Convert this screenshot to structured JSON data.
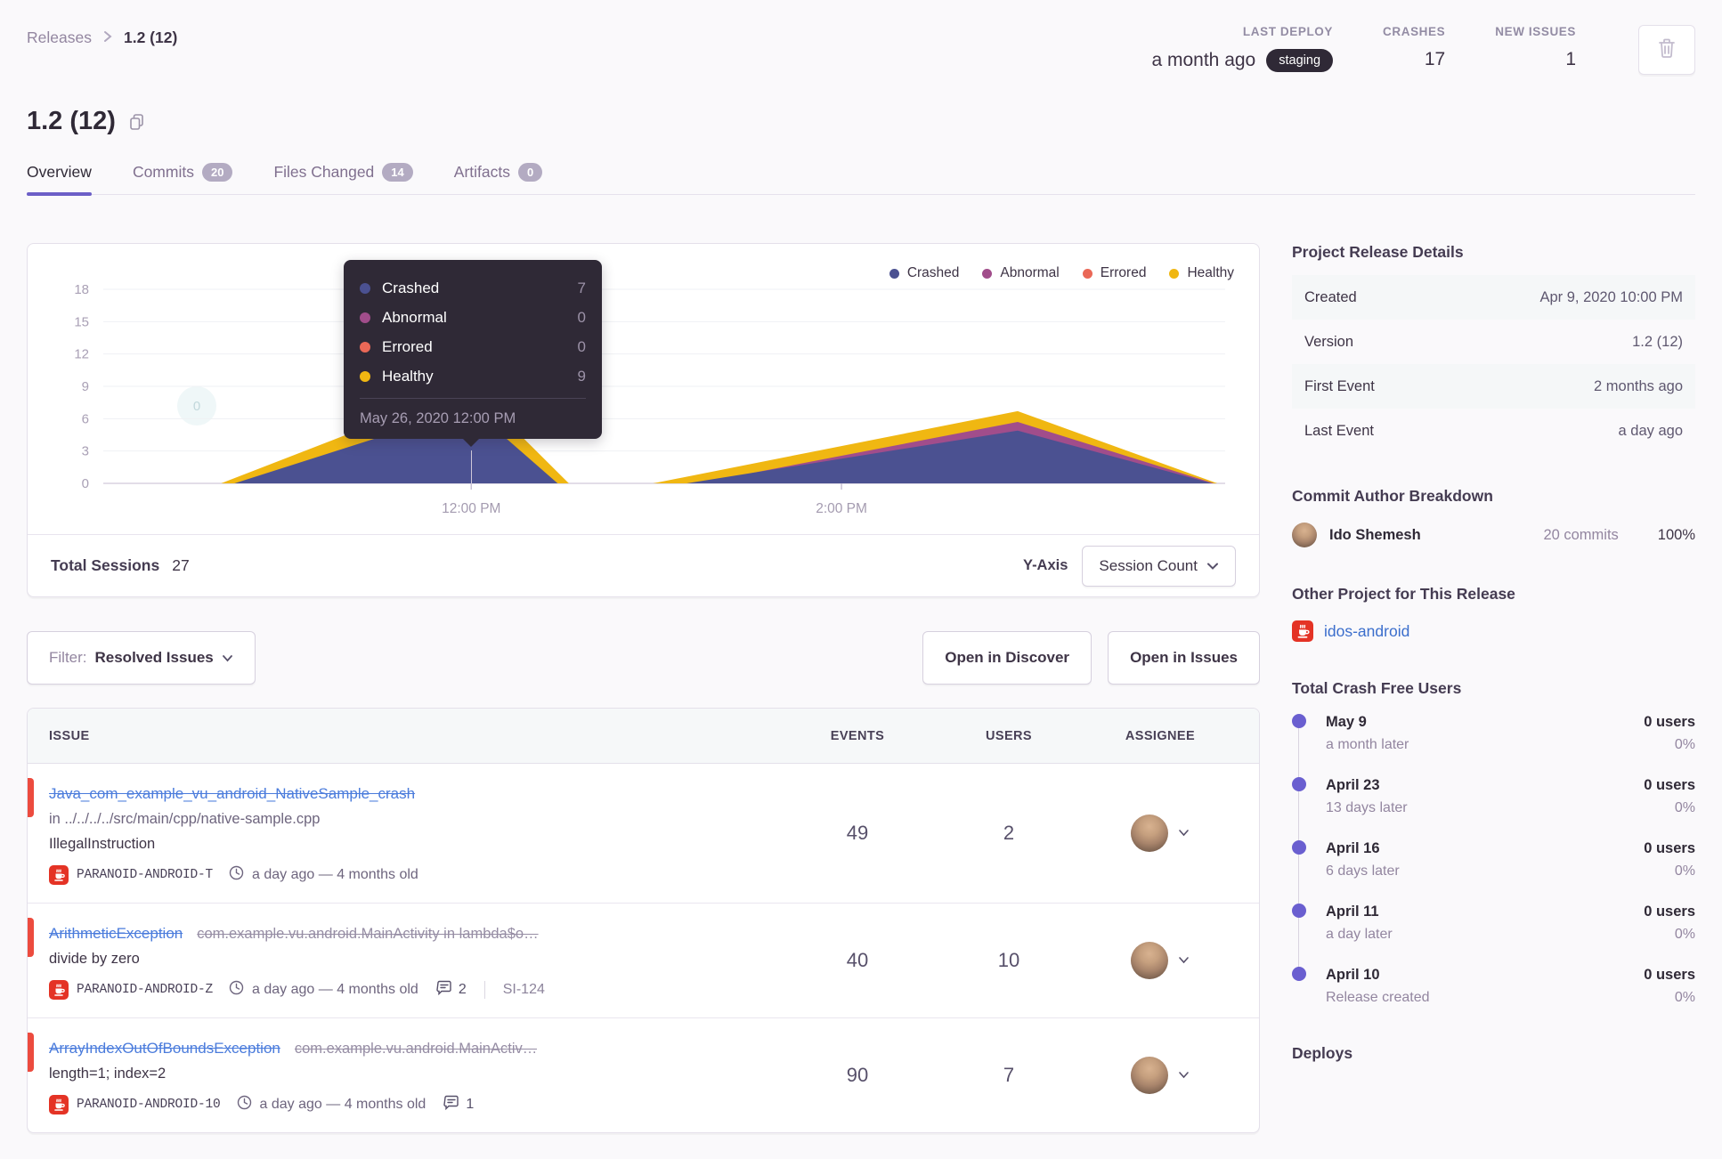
{
  "breadcrumb": {
    "parent": "Releases",
    "current": "1.2 (12)"
  },
  "header_stats": {
    "last_deploy": {
      "label": "LAST DEPLOY",
      "value": "a month ago",
      "badge": "staging"
    },
    "crashes": {
      "label": "CRASHES",
      "value": "17"
    },
    "new_issues": {
      "label": "NEW ISSUES",
      "value": "1"
    }
  },
  "page_title": "1.2 (12)",
  "tabs": [
    {
      "label": "Overview"
    },
    {
      "label": "Commits",
      "count": "20"
    },
    {
      "label": "Files Changed",
      "count": "14"
    },
    {
      "label": "Artifacts",
      "count": "0"
    }
  ],
  "chart_data": {
    "type": "area",
    "legend": [
      "Crashed",
      "Abnormal",
      "Errored",
      "Healthy"
    ],
    "colors": {
      "Crashed": "#4B5191",
      "Abnormal": "#A14D8B",
      "Errored": "#EA6857",
      "Healthy": "#F0B712"
    },
    "y_ticks": [
      0,
      3,
      6,
      9,
      12,
      15,
      18
    ],
    "ylim": [
      0,
      19
    ],
    "x_ticks": [
      {
        "label": "12:00 PM",
        "f": 0.328
      },
      {
        "label": "2:00 PM",
        "f": 0.658
      }
    ],
    "series": [
      {
        "name": "Crashed",
        "points": [
          [
            0.117,
            0
          ],
          [
            0.328,
            7
          ],
          [
            0.405,
            0
          ],
          [
            0.52,
            0
          ],
          [
            0.815,
            4.9
          ],
          [
            0.988,
            0
          ]
        ]
      },
      {
        "name": "Abnormal",
        "points": [
          [
            0.53,
            0
          ],
          [
            0.815,
            5.7
          ],
          [
            0.99,
            0
          ]
        ]
      },
      {
        "name": "Errored",
        "points": []
      },
      {
        "name": "Healthy",
        "points": [
          [
            0.105,
            0
          ],
          [
            0.328,
            9
          ],
          [
            0.415,
            0
          ],
          [
            0.49,
            0
          ],
          [
            0.815,
            6.7
          ],
          [
            0.993,
            0
          ]
        ]
      }
    ],
    "draw_order": [
      "Healthy",
      "Abnormal",
      "Errored",
      "Crashed"
    ],
    "hover": {
      "date": "May 26, 2020 12:00 PM",
      "x_f": 0.328,
      "rows": [
        [
          "Crashed",
          7
        ],
        [
          "Abnormal",
          0
        ],
        [
          "Errored",
          0
        ],
        [
          "Healthy",
          9
        ]
      ]
    },
    "faded_label": "0"
  },
  "chart_footer": {
    "total_sessions_label": "Total Sessions",
    "total_sessions_value": "27",
    "yaxis_label": "Y-Axis",
    "yaxis_value": "Session Count"
  },
  "filter_bar": {
    "filter_label": "Filter:",
    "filter_value": "Resolved Issues",
    "discover_button": "Open in Discover",
    "issues_button": "Open in Issues"
  },
  "issues_table": {
    "columns": [
      "ISSUE",
      "EVENTS",
      "USERS",
      "ASSIGNEE"
    ],
    "rows": [
      {
        "title": "Java_com_example_vu_android_NativeSample_crash",
        "location": "in ../../../../src/main/cpp/native-sample.cpp",
        "message": "IllegalInstruction",
        "project": "PARANOID-ANDROID-T",
        "age": "a day ago — 4 months old",
        "events": "49",
        "users": "2"
      },
      {
        "title": "ArithmeticException",
        "culprit": "com.example.vu.android.MainActivity in lambda$o…",
        "message": "divide by zero",
        "project": "PARANOID-ANDROID-Z",
        "age": "a day ago — 4 months old",
        "comments": "2",
        "ticket": "SI-124",
        "events": "40",
        "users": "10"
      },
      {
        "title": "ArrayIndexOutOfBoundsException",
        "culprit": "com.example.vu.android.MainActiv…",
        "message": "length=1; index=2",
        "project": "PARANOID-ANDROID-10",
        "age": "a day ago — 4 months old",
        "comments": "1",
        "events": "90",
        "users": "7"
      }
    ]
  },
  "sidebar": {
    "release_details": {
      "title": "Project Release Details",
      "rows": [
        {
          "label": "Created",
          "value": "Apr 9, 2020 10:00 PM"
        },
        {
          "label": "Version",
          "value": "1.2 (12)"
        },
        {
          "label": "First Event",
          "value": "2 months ago"
        },
        {
          "label": "Last Event",
          "value": "a day ago"
        }
      ]
    },
    "commit_authors": {
      "title": "Commit Author Breakdown",
      "rows": [
        {
          "name": "Ido Shemesh",
          "commits": "20 commits",
          "percent": "100%"
        }
      ]
    },
    "other_project": {
      "title": "Other Project for This Release",
      "project": "idos-android"
    },
    "crash_free": {
      "title": "Total Crash Free Users",
      "items": [
        {
          "date": "May 9",
          "rel": "a month later",
          "users": "0 users",
          "pct": "0%"
        },
        {
          "date": "April 23",
          "rel": "13 days later",
          "users": "0 users",
          "pct": "0%"
        },
        {
          "date": "April 16",
          "rel": "6 days later",
          "users": "0 users",
          "pct": "0%"
        },
        {
          "date": "April 11",
          "rel": "a day later",
          "users": "0 users",
          "pct": "0%"
        },
        {
          "date": "April 10",
          "rel": "Release created",
          "users": "0 users",
          "pct": "0%"
        }
      ]
    },
    "deploys_title": "Deploys"
  }
}
